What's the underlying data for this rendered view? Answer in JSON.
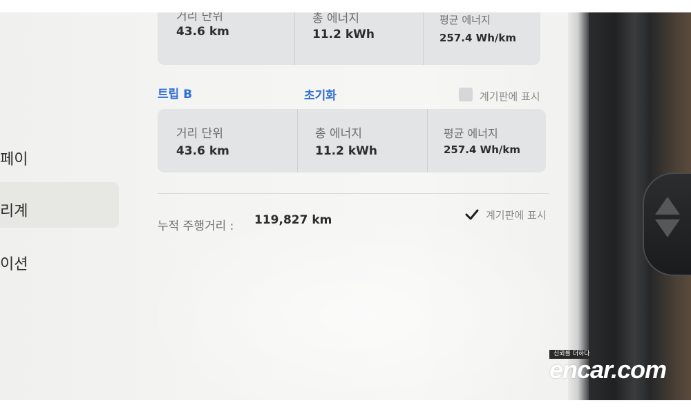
{
  "menu": {
    "items": [
      {
        "label": "페이"
      },
      {
        "label": "리계"
      },
      {
        "label": "이션"
      }
    ]
  },
  "trip_a": {
    "cells": [
      {
        "label": "거리 단위",
        "value": "43.6 km"
      },
      {
        "label": "총 에너지",
        "value": "11.2 kWh"
      },
      {
        "label": "평균 에너지",
        "value": "257.4 Wh/km"
      }
    ]
  },
  "trip_b": {
    "title": "트립 B",
    "reset_label": "초기화",
    "show_on_dashboard_label": "계기판에 표시",
    "show_on_dashboard_checked": false,
    "cells": [
      {
        "label": "거리 단위",
        "value": "43.6 km"
      },
      {
        "label": "총 에너지",
        "value": "11.2 kWh"
      },
      {
        "label": "평균 에너지",
        "value": "257.4 Wh/km"
      }
    ]
  },
  "odometer": {
    "label": "누적 주행거리 :",
    "value": "119,827 km",
    "show_on_dashboard_label": "계기판에 표시",
    "show_on_dashboard_checked": true
  },
  "watermark": {
    "tagline": "신뢰를 더하다",
    "logo": "encar.com"
  },
  "colors": {
    "accent": "#2f6ed6",
    "card_bg": "#e3e4e5",
    "page_bg": "#f3f3f1"
  }
}
